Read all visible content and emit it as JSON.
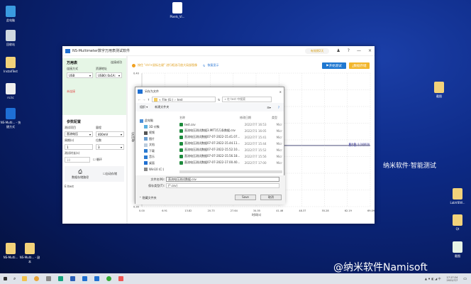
{
  "desktop": {
    "left_icons": [
      {
        "label": "此电脑"
      },
      {
        "label": "回收站"
      },
      {
        "label": "InstallTest"
      },
      {
        "label": "rs.lic"
      },
      {
        "label": "NS-Multi... - 快捷方式"
      },
      {
        "label": "NS-Multi..."
      },
      {
        "label": "NS-Multi... - 副本"
      }
    ],
    "top_icon": {
      "label": "Pixels_Vi..."
    },
    "right_icons": [
      {
        "label": "截图"
      },
      {
        "label": "LabVIEW..."
      },
      {
        "label": "Qt"
      },
      {
        "label": "截图"
      }
    ],
    "watermark": "纳米软件·智能测试",
    "weibo": "@纳米软件Namisoft"
  },
  "window": {
    "title": "NS-Multimeter数字万用表测试软件",
    "badge": "有效期2天",
    "controls": [
      "—",
      "×"
    ]
  },
  "left": {
    "section1": "万用表",
    "disconnect": "连接成功",
    "conn_mode_label": "连接方式",
    "conn_mode": "USB",
    "addr_label": "资源地址",
    "addr": "USB0::0x1A:",
    "not_connected": "未连接",
    "section2": "参数配置",
    "meas_label": "测试项目",
    "meas": "直流电压",
    "range_label": "量程",
    "range": "400mV",
    "period_label": "周期(s)",
    "period": "1",
    "digits_label": "位数",
    "digits": "3",
    "duration_label": "测试时长(s)",
    "duration": "10",
    "loop": "循环",
    "save_path_label": "数据存储路径",
    "auto_save": "自动存储",
    "path": "E:\\test"
  },
  "toolbar": {
    "hint": "按住 \"ctrl+鼠标左键\" 进行框选可放大局部图像",
    "restore": "恢复显示",
    "start": "开始测试",
    "save": "数据存储"
  },
  "chart_data": {
    "type": "line",
    "ylabel": "电压(V)",
    "xlabel": "时间(s)",
    "ylim": [
      0.3,
      0.4
    ],
    "ytick_labels": [
      "0.40",
      "0.30"
    ],
    "xtick_labels": [
      "0.00",
      "6.91",
      "13.82",
      "20.73",
      "27.64",
      "34.55",
      "41.46",
      "48.37",
      "55.28",
      "62.19",
      "69.09"
    ],
    "xlim": [
      0,
      69.09
    ],
    "grid": true,
    "max_label": "最大值: 0.345830",
    "avg_label": "平均值: 0.345820",
    "min_label": "最小值: 0.345730",
    "max": 0.3458,
    "avg": 0.34578,
    "min": 0.34573,
    "series": [
      {
        "x": [
          40,
          41.5,
          43,
          44.5,
          46,
          47.5,
          49,
          50.5,
          52,
          53.5,
          55,
          56.5,
          58,
          59.5,
          61,
          62.5,
          64,
          65.5,
          67,
          68.5,
          69.09
        ],
        "y": [
          0.34578,
          0.34578,
          0.34573,
          0.34583,
          0.34577,
          0.34583,
          0.34575,
          0.34583,
          0.34583,
          0.34574,
          0.34583,
          0.34574,
          0.34578,
          0.34583,
          0.34573,
          0.3458,
          0.34576,
          0.34583,
          0.34577,
          0.34581,
          0.34578
        ]
      }
    ]
  },
  "dialog": {
    "title": "另存为文件",
    "path": [
      "File (G:)",
      "test"
    ],
    "search": "在 test 中搜索",
    "organize": "组织 ▾",
    "new_folder": "新建文件夹",
    "nav": [
      "此电脑",
      "3D 对象",
      "视频",
      "图片",
      "文档",
      "下载",
      "音乐",
      "桌面",
      "Win10 (C:)"
    ],
    "columns": [
      "名称",
      "修改日期",
      "类型"
    ],
    "files": [
      {
        "name": "test.csv",
        "date": "2022/7/7 16:53",
        "type": "Micr"
      },
      {
        "name": "直流电压测试数据3.MIT15万条数据.csv",
        "date": "2022/7/1 16:05",
        "type": "Micr"
      },
      {
        "name": "直流电压测试数据07-07-2022-15.41.07...",
        "date": "2022/7/7 15:41",
        "type": "Micr"
      },
      {
        "name": "直流电压测试数据07-07-2022-15.44.11...",
        "date": "2022/7/7 15:44",
        "type": "Micr"
      },
      {
        "name": "直流电压测试数据07-07-2022-15.52.10...",
        "date": "2022/7/7 15:52",
        "type": "Micr"
      },
      {
        "name": "直流电压测试数据07-07-2022-15.56.18...",
        "date": "2022/7/7 15:56",
        "type": "Micr"
      },
      {
        "name": "直流电压测试数据07-07-2022-17.00.40...",
        "date": "2022/7/7 17:00",
        "type": "Micr"
      }
    ],
    "filename_label": "文件名(N):",
    "filename": "直流电压测试数据.csv",
    "type_label": "保存类型(T):",
    "filetype": "(*.csv)",
    "hide_folders": "隐藏文件夹",
    "save": "Save",
    "cancel": "取消"
  },
  "taskbar": {
    "time": "17:17:24",
    "date": "2022/7/7",
    "ime": "中"
  }
}
